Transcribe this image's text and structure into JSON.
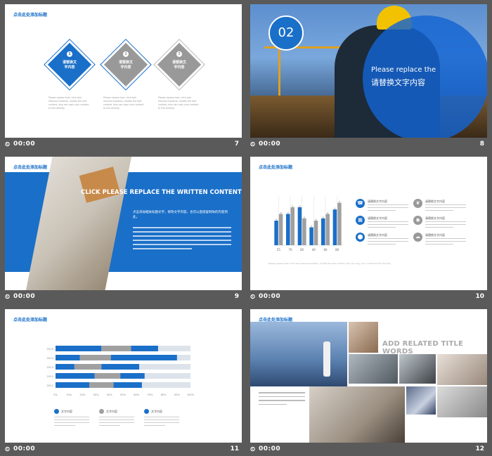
{
  "slides": [
    {
      "number": "7",
      "time": "00:00",
      "title": "点击此处添加标题",
      "items": [
        {
          "badge": "1",
          "text_line1": "请替换文",
          "text_line2": "字内容"
        },
        {
          "badge": "2",
          "text_line1": "请替换文",
          "text_line2": "字内容"
        },
        {
          "badge": "3",
          "text_line1": "请替换文",
          "text_line2": "字内容"
        }
      ],
      "caption": "Please replace text, click add relevant headline, modify the text content, also can copy your content to this directly."
    },
    {
      "number": "8",
      "time": "00:00",
      "badge_number": "02",
      "heading_en": "Please replace the",
      "heading_cn": "请替换文字内容"
    },
    {
      "number": "9",
      "time": "00:00",
      "title": "点击此处添加标题",
      "heading_en": "CLICK PLEASE REPLACE THE WRITTEN CONTENT",
      "subtitle_cn": "点击添加相关标题文字，修改文字内容，也可以直接复制你的内容到此。"
    },
    {
      "number": "10",
      "time": "00:00",
      "title": "点击此处添加标题",
      "chart_data": {
        "type": "bar",
        "categories": [
          "55",
          "70",
          "85",
          "40",
          "60",
          "80"
        ],
        "series": [
          {
            "values": [
              55,
              70,
              85,
              40,
              60,
              80
            ]
          },
          {
            "values": [
              70,
              85,
              60,
              55,
              70,
              95
            ]
          }
        ],
        "ylim": [
          0,
          110
        ]
      },
      "features": [
        {
          "icon": "phone-icon",
          "glyph": "☎",
          "label": "请替换文字内容",
          "color": "#1a6fc8"
        },
        {
          "icon": "leaf-icon",
          "glyph": "❦",
          "label": "请替换文字内容",
          "color": "#999999"
        },
        {
          "icon": "calendar-icon",
          "glyph": "▦",
          "label": "请替换文字内容",
          "color": "#1a6fc8"
        },
        {
          "icon": "pin-icon",
          "glyph": "◉",
          "label": "请替换文字内容",
          "color": "#999999"
        },
        {
          "icon": "location-icon",
          "glyph": "⬤",
          "label": "请替换文字内容",
          "color": "#1a6fc8"
        },
        {
          "icon": "cloud-icon",
          "glyph": "☁",
          "label": "请替换文字内容",
          "color": "#999999"
        }
      ],
      "caption": "Please replace text, click add relevant headline, modify the text content, also can copy your content to this directly."
    },
    {
      "number": "11",
      "time": "00:00",
      "title": "点击此处添加标题",
      "chart_data": {
        "type": "bar",
        "orientation": "horizontal",
        "stacked": true,
        "categories": [
          "2015",
          "2014",
          "2013",
          "2012",
          "2011"
        ],
        "x_ticks": [
          "0%",
          "10%",
          "20%",
          "30%",
          "40%",
          "50%",
          "60%",
          "70%",
          "80%",
          "90%",
          "100%"
        ],
        "xlim": [
          0,
          100
        ],
        "series": [
          {
            "name": "文字内容",
            "color": "#1a6fc8",
            "values": [
              34,
              18,
              14,
              29,
              25
            ]
          },
          {
            "name": "文字内容",
            "color": "#a0a0a0",
            "values": [
              22,
              23,
              20,
              19,
              18
            ]
          },
          {
            "name": "文字内容",
            "color": "#1a6fc8",
            "values": [
              20,
              49,
              28,
              18,
              21
            ]
          }
        ]
      },
      "legend": [
        {
          "label": "文字内容",
          "color": "#1a6fc8"
        },
        {
          "label": "文字内容",
          "color": "#a0a0a0"
        },
        {
          "label": "文字内容",
          "color": "#1a6fc8"
        }
      ]
    },
    {
      "number": "12",
      "time": "00:00",
      "title": "点击此处添加标题",
      "heading_en": "ADD RELATED  TITLE WORDS"
    }
  ],
  "colors": {
    "accent": "#1a6fc8",
    "gray": "#999999",
    "background": "#5a5a5a"
  }
}
